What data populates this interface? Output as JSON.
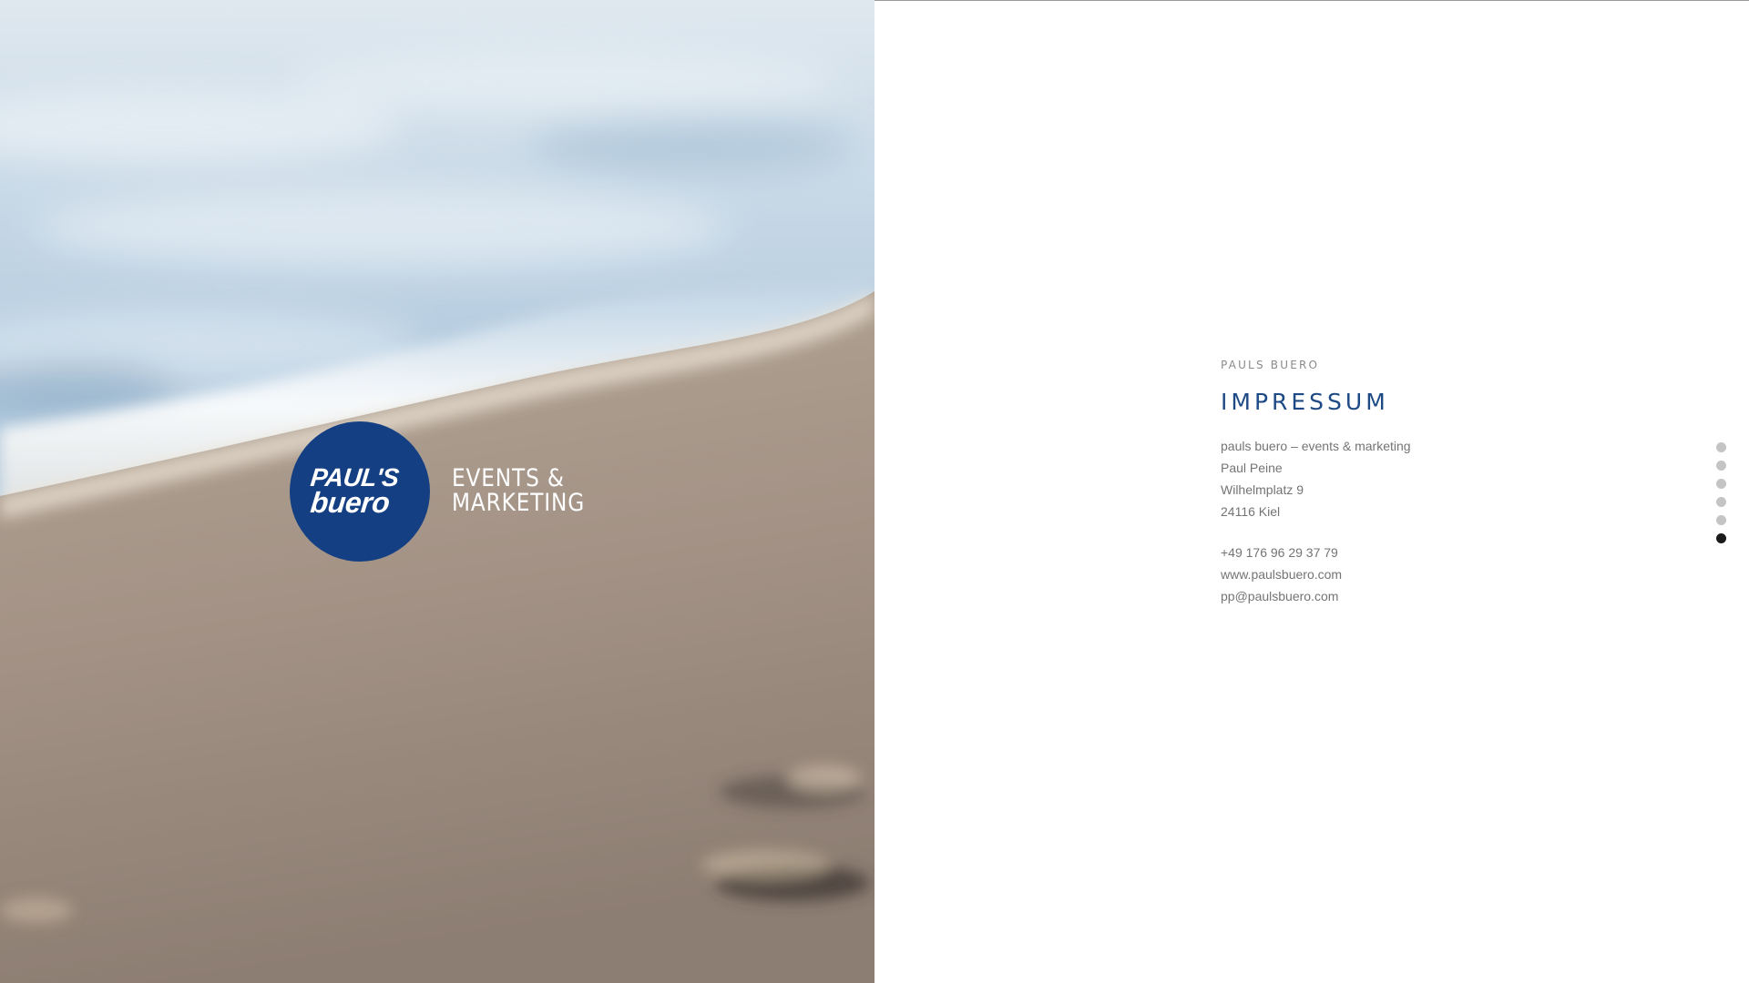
{
  "hero": {
    "logo": {
      "line1": "PAUL'S",
      "line2": "buero",
      "tagline_line1": "EVENTS &",
      "tagline_line2": "MARKETING",
      "color": "#143f83"
    }
  },
  "impressum": {
    "eyebrow": "PAULS BUERO",
    "title": "IMPRESSUM",
    "address_lines": [
      "pauls buero – events & marketing",
      "Paul Peine",
      "Wilhelmplatz 9",
      "24116 Kiel"
    ],
    "contact": {
      "phone": "+49 176 96 29 37 79",
      "website": "www.paulsbuero.com",
      "email": "pp@paulsbuero.com"
    },
    "title_color": "#1d4a84"
  },
  "section_nav": {
    "count": 6,
    "active_index": 5,
    "active_color": "#1a1a1a",
    "inactive_color": "#c4c4c4"
  }
}
